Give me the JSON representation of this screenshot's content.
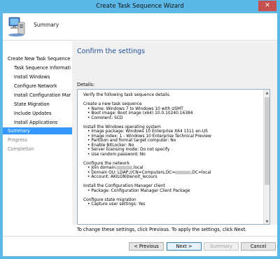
{
  "window": {
    "title": "Create Task Sequence Wizard",
    "close_glyph": "✕"
  },
  "header": {
    "title": "Summary",
    "icon": "computer-wizard-icon"
  },
  "nav": {
    "items": [
      {
        "label": "Create New Task Sequence",
        "state": "normal"
      },
      {
        "label": "Task Sequence Informati",
        "state": "normal"
      },
      {
        "label": "Install Windows",
        "state": "normal"
      },
      {
        "label": "Configure Network",
        "state": "normal"
      },
      {
        "label": "Install Configuration Mar",
        "state": "normal"
      },
      {
        "label": "State Migration",
        "state": "normal"
      },
      {
        "label": "Include Updates",
        "state": "normal"
      },
      {
        "label": "Install Applications",
        "state": "normal"
      },
      {
        "label": "Summary",
        "state": "selected"
      },
      {
        "label": "Progress",
        "state": "disabled"
      },
      {
        "label": "Completion",
        "state": "disabled"
      }
    ]
  },
  "content": {
    "title": "Confirm the settings",
    "details_label": "Details:",
    "details": {
      "verify": "Verify the following task sequence details.",
      "s1_title": "Create a new task sequence",
      "s1_b1": "Name: Windows 7 to Windows 10 with USMT",
      "s1_b2": "Boot image: Boot image (x64) 10.0.10240.16384",
      "s1_b3": "Comment: SCD",
      "s2_title": "Install the Windows operating system",
      "s2_b1": "Image package: Windows 10 Enterprise X64 1511 en-US",
      "s2_b2": "Image index: 1 - Windows 10 Enterprise Technical Preview",
      "s2_b3": "Partition and format target computer: No",
      "s2_b4": "Enable BitLocker: No",
      "s2_b5": "Server licensing mode: Do not specify",
      "s2_b6": "Use random password: No",
      "s3_title": "Configure the network",
      "s3_b1_pre": "Join domain:",
      "s3_b1_post": ".local",
      "s3_b2_pre": "Domain OU: LDAP://CN=Computers,DC=",
      "s3_b2_post": ",DC=local",
      "s3_b3": "Account: AKILON\\benoit_lecours",
      "s4_title": "Install the Configuration Manager client",
      "s4_b1": "Package: Configuration Manager Client Package",
      "s5_title": "Configure state migration",
      "s5_b1": "Capture user settings: Yes"
    },
    "hint": "To change these settings, click Previous. To apply the settings, click Next."
  },
  "buttons": {
    "previous": "< Previous",
    "next": "Next >",
    "summary": "Summary",
    "cancel": "Cancel"
  }
}
